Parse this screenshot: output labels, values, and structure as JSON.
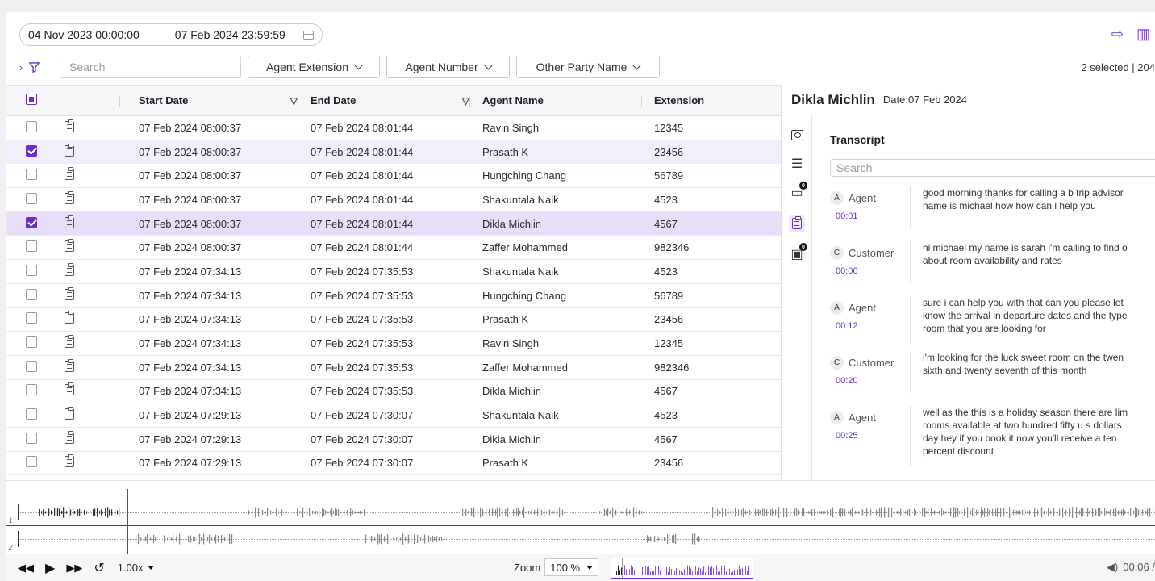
{
  "date_range": {
    "start": "04 Nov 2023 00:00:00",
    "sep": "—",
    "end": "07 Feb 2024 23:59:59"
  },
  "filters": {
    "search_placeholder": "Search",
    "dropdowns": [
      "Agent Extension",
      "Agent Number",
      "Other Party Name"
    ],
    "selected_info": "2 selected | 204"
  },
  "table": {
    "columns": [
      "Start Date",
      "End Date",
      "Agent Name",
      "Extension"
    ],
    "rows": [
      {
        "start": "07 Feb 2024 08:00:37",
        "end": "07 Feb 2024 08:01:44",
        "agent": "Ravin Singh",
        "ext": "12345",
        "checked": false
      },
      {
        "start": "07 Feb 2024 08:00:37",
        "end": "07 Feb 2024 08:01:44",
        "agent": "Prasath K",
        "ext": "23456",
        "checked": true
      },
      {
        "start": "07 Feb 2024 08:00:37",
        "end": "07 Feb 2024 08:01:44",
        "agent": "Hungching Chang",
        "ext": "56789",
        "checked": false
      },
      {
        "start": "07 Feb 2024 08:00:37",
        "end": "07 Feb 2024 08:01:44",
        "agent": "Shakuntala Naik",
        "ext": "4523",
        "checked": false
      },
      {
        "start": "07 Feb 2024 08:00:37",
        "end": "07 Feb 2024 08:01:44",
        "agent": "Dikla Michlin",
        "ext": "4567",
        "checked": true,
        "active": true
      },
      {
        "start": "07 Feb 2024 08:00:37",
        "end": "07 Feb 2024 08:01:44",
        "agent": "Zaffer Mohammed",
        "ext": "982346",
        "checked": false
      },
      {
        "start": "07 Feb 2024 07:34:13",
        "end": "07 Feb 2024 07:35:53",
        "agent": "Shakuntala Naik",
        "ext": "4523",
        "checked": false
      },
      {
        "start": "07 Feb 2024 07:34:13",
        "end": "07 Feb 2024 07:35:53",
        "agent": "Hungching Chang",
        "ext": "56789",
        "checked": false
      },
      {
        "start": "07 Feb 2024 07:34:13",
        "end": "07 Feb 2024 07:35:53",
        "agent": "Prasath K",
        "ext": "23456",
        "checked": false
      },
      {
        "start": "07 Feb 2024 07:34:13",
        "end": "07 Feb 2024 07:35:53",
        "agent": "Ravin Singh",
        "ext": "12345",
        "checked": false
      },
      {
        "start": "07 Feb 2024 07:34:13",
        "end": "07 Feb 2024 07:35:53",
        "agent": "Zaffer Mohammed",
        "ext": "982346",
        "checked": false
      },
      {
        "start": "07 Feb 2024 07:34:13",
        "end": "07 Feb 2024 07:35:53",
        "agent": "Dikla Michlin",
        "ext": "4567",
        "checked": false
      },
      {
        "start": "07 Feb 2024 07:29:13",
        "end": "07 Feb 2024 07:30:07",
        "agent": "Shakuntala Naik",
        "ext": "4523",
        "checked": false
      },
      {
        "start": "07 Feb 2024 07:29:13",
        "end": "07 Feb 2024 07:30:07",
        "agent": "Dikla Michlin",
        "ext": "4567",
        "checked": false
      },
      {
        "start": "07 Feb 2024 07:29:13",
        "end": "07 Feb 2024 07:30:07",
        "agent": "Prasath K",
        "ext": "23456",
        "checked": false
      }
    ]
  },
  "panel": {
    "name": "Dikla Michlin",
    "date": "Date:07 Feb 2024",
    "transcript_title": "Transcript",
    "search_placeholder": "Search",
    "badge_count_1": "0",
    "badge_count_2": "0",
    "entries": [
      {
        "avatar": "A",
        "role": "Agent",
        "time": "00:01",
        "text": "good morning thanks for calling a b trip advisor\nname is michael how how can i help you"
      },
      {
        "avatar": "C",
        "role": "Customer",
        "time": "00:06",
        "text": "hi michael my name is sarah i'm calling to find o\nabout room availability and rates"
      },
      {
        "avatar": "A",
        "role": "Agent",
        "time": "00:12",
        "text": "sure i can help you with that can you please let\nknow the arrival in departure dates and the type\nroom that you are looking for"
      },
      {
        "avatar": "C",
        "role": "Customer",
        "time": "00:20",
        "text": "i'm looking for the luck sweet room on the twen\nsixth and twenty seventh of this month"
      },
      {
        "avatar": "A",
        "role": "Agent",
        "time": "00:25",
        "text": "well as the this is a holiday season there are lim\nrooms available at two hundred fifty u s dollars\nday hey if you book it now you'll receive a ten\npercent discount"
      }
    ]
  },
  "waveform": {
    "tracks": [
      "1",
      "2"
    ]
  },
  "player": {
    "speed": "1.00x",
    "zoom_label": "Zoom",
    "zoom_value": "100 %",
    "time": "00:06 /"
  },
  "accent_color": "#6a2fc7"
}
